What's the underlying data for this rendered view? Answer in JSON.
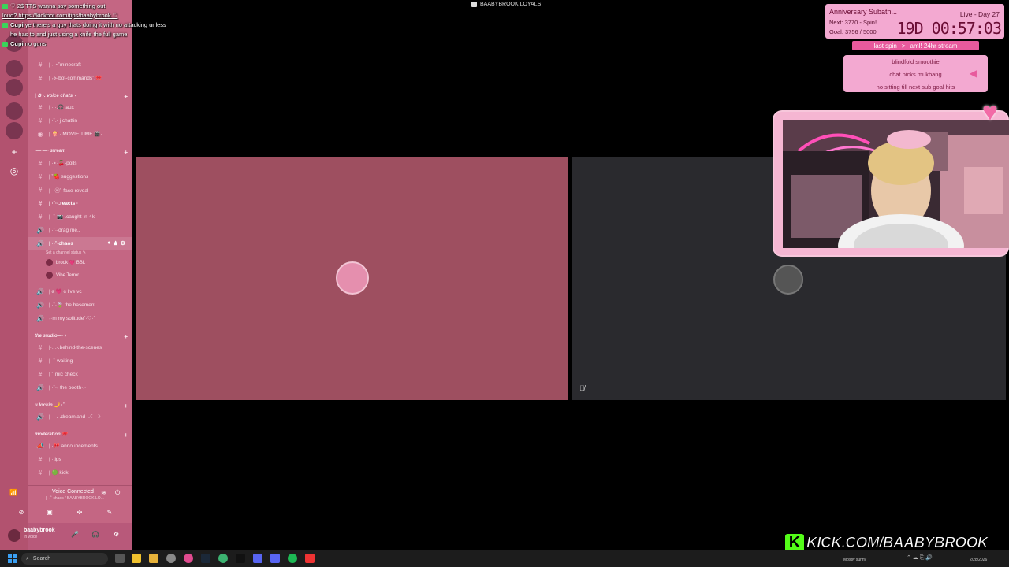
{
  "window": {
    "title": "BAABYBROOK LOYALS"
  },
  "chat": [
    {
      "prefix": "",
      "text": "♡ 2$ TTS wanna say something out"
    },
    {
      "prefix": "",
      "text": "loud? https://kickbot.com/tips/baabybrook ♡"
    },
    {
      "prefix": "Cupi",
      "text": "ye there's a guy thats doing it with no attacking unless he has to and just using a knife the full game"
    },
    {
      "prefix": "Cupi",
      "text": "no guns"
    }
  ],
  "sidebar": {
    "top_items": [
      {
        "name": "minecraft",
        "label": "| ˖·⋆˚minecraft"
      },
      {
        "name": "bot-commands",
        "label": "| ˖⟡-bot-commands˚.🎀"
      }
    ],
    "categories": {
      "voice": "| ✿ ·. voice chats ⋆",
      "stream": "·—·—· stream",
      "studio": "the studio—·⋆",
      "lockin": "u lockin 🌙 ·˚·",
      "moderation": "moderation 🎀"
    },
    "voice_channels": [
      {
        "name": "aux",
        "label": "| ·.·.🎧 aux"
      },
      {
        "name": "chattin",
        "label": "| ·˚.· j chattin"
      },
      {
        "name": "movie-time",
        "label": "| 🍿 · MOVIE TIME 🎬·"
      }
    ],
    "stream_channels": [
      {
        "name": "polls",
        "label": "| ·⋆·🍒-polls"
      },
      {
        "name": "suggestions",
        "label": "| ˚🍓 suggestions"
      },
      {
        "name": "face-reveal",
        "label": "| ·.ⓦ˚-face-reveal"
      },
      {
        "name": "reacts",
        "label": "| ·˚·-.reacts ·"
      },
      {
        "name": "caught-in-4k",
        "label": "| ·˚·📷·.caught-in-4k"
      },
      {
        "name": "drag-me",
        "label": "| ·˚·-drag me.."
      },
      {
        "name": "chaos",
        "label": "| ·˖˚·chaos"
      }
    ],
    "channel_status_hint": "Set a channel status ✎",
    "voice_users": [
      {
        "name": "brook",
        "label": "brook 💗 BBL"
      },
      {
        "name": "vibe-terror",
        "label": "Vibe Terror"
      }
    ],
    "more_voice": [
      {
        "name": "live-vc",
        "label": "| ɞ 💗 ɞ live vc"
      },
      {
        "name": "the-basement",
        "label": "| ·˚·🍃 the basement"
      },
      {
        "name": "my-solitude",
        "label": "˖·m my solitude˚·♡·˚"
      }
    ],
    "studio_channels": [
      {
        "name": "behind-the-scenes",
        "label": "|·.·.·.behind-the-scenes"
      },
      {
        "name": "waiting",
        "label": "| ·˚·waiting"
      },
      {
        "name": "mic-check",
        "label": "| ˚·mic check"
      },
      {
        "name": "the-booth",
        "label": "| ·˚·˖ the booth·.·"
      }
    ],
    "lockin_channels": [
      {
        "name": "dreamland",
        "label": "| ·.·.·.dreamland ·.☾·☽"
      }
    ],
    "moderation_channels": [
      {
        "name": "announcements",
        "label": "| ·🎀 announcements"
      },
      {
        "name": "tips",
        "label": "| ·tips"
      },
      {
        "name": "kick",
        "label": "| 🟢 kick"
      }
    ],
    "voice_panel": {
      "status": "Voice Connected",
      "channel": "| ·˖˚·chaos / BAABYBROOK LO..."
    },
    "user": {
      "name": "baabybrook",
      "status": "In voice"
    }
  },
  "subathon": {
    "title": "Anniversary Subath...",
    "next": "Next: 3770 - Spin!",
    "goal": "Goal: 3756 / 5000",
    "live": "Live - Day 27",
    "timer": "19D 00:57:03"
  },
  "spin": {
    "last_label": "last spin",
    "arrow": ">",
    "last_value": "aml! 24hr stream",
    "items": [
      "blindfold smoothie",
      "chat picks mukbang",
      "no sitting till next sub goal hits"
    ]
  },
  "kick_banner": {
    "logo": "K",
    "text": "KICK.COM/BAABYBROOK"
  },
  "taskbar": {
    "search_placeholder": "Search",
    "weather": "Mostly sunny",
    "date": "2/28/2026"
  },
  "colors": {
    "server_rail": "#b2526f",
    "sidebar": "#c46683",
    "tile_left": "#9e4f60",
    "tile_right": "#2a2a2e",
    "widget_pink": "#f3a9d1",
    "accent_pink": "#e85a9d",
    "kick_green": "#53fc18"
  }
}
